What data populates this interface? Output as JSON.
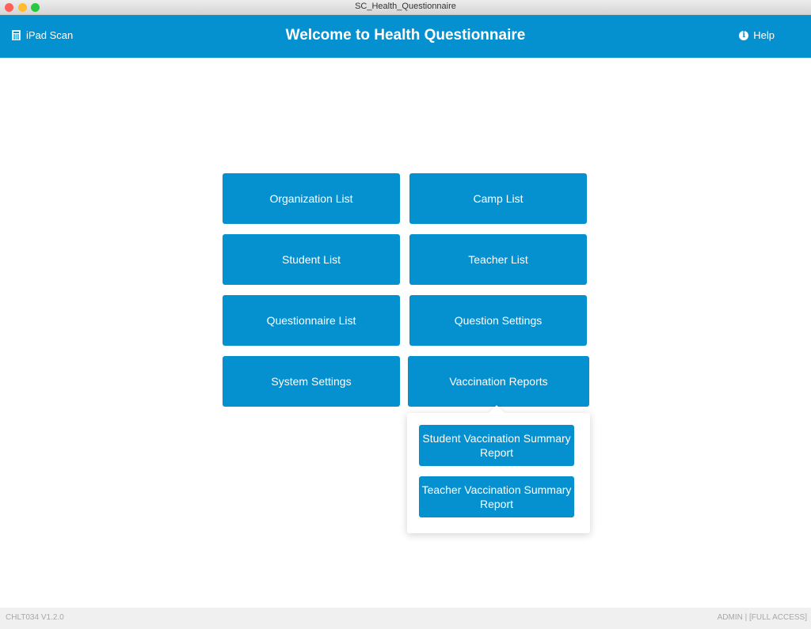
{
  "window": {
    "title": "SC_Health_Questionnaire"
  },
  "header": {
    "left_label": "iPad Scan",
    "left_icon": "calculator-icon",
    "title": "Welcome to Health Questionnaire",
    "right_label": "Help",
    "right_icon": "info-icon",
    "info_glyph": "i",
    "accent_color": "#0590cf"
  },
  "menu": {
    "buttons": [
      {
        "label": "Organization List"
      },
      {
        "label": "Camp List"
      },
      {
        "label": "Student List"
      },
      {
        "label": "Teacher List"
      },
      {
        "label": "Questionnaire List"
      },
      {
        "label": "Question Settings"
      },
      {
        "label": "System Settings"
      },
      {
        "label": "Vaccination Reports"
      }
    ]
  },
  "popover": {
    "items": [
      {
        "label": "Student Vaccination Summary Report"
      },
      {
        "label": "Teacher Vaccination Summary Report"
      }
    ]
  },
  "footer": {
    "version": "CHLT034 V1.2.0",
    "user": "ADMIN | [FULL ACCESS]"
  }
}
